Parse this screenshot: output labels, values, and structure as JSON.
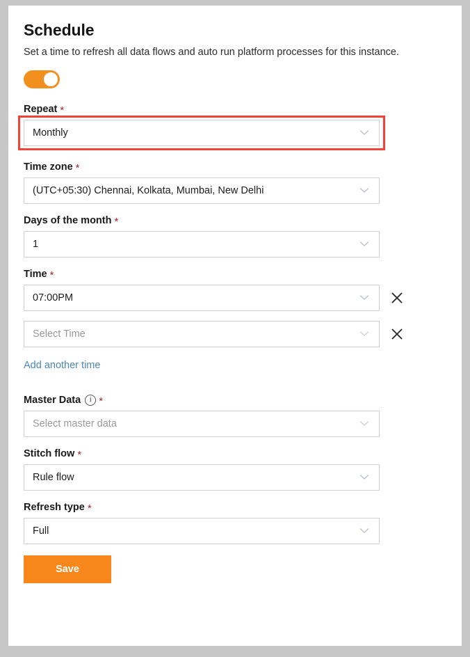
{
  "card": {
    "title": "Schedule",
    "subtitle": "Set a time to refresh all data flows and auto run platform processes for this instance."
  },
  "toggle": {
    "state": "on",
    "color": "#f2901e"
  },
  "fields": {
    "repeat": {
      "label": "Repeat",
      "required": "*",
      "value": "Monthly",
      "highlighted": true,
      "highlight_color": "#f04438"
    },
    "timezone": {
      "label": "Time zone",
      "required": "*",
      "value": "(UTC+05:30) Chennai, Kolkata, Mumbai, New Delhi"
    },
    "days_of_month": {
      "label": "Days of the month",
      "required": "*",
      "value": "1"
    },
    "time": {
      "label": "Time",
      "required": "*",
      "rows": [
        {
          "value": "07:00PM",
          "is_placeholder": false
        },
        {
          "value": "Select Time",
          "is_placeholder": true
        }
      ],
      "add_link": "Add another time"
    },
    "master_data": {
      "label": "Master Data",
      "required": "*",
      "info_icon": "info-icon",
      "value": "Select master data",
      "is_placeholder": true
    },
    "stitch_flow": {
      "label": "Stitch flow",
      "required": "*",
      "value": "Rule flow"
    },
    "refresh_type": {
      "label": "Refresh type",
      "required": "*",
      "value": "Full"
    }
  },
  "actions": {
    "save_label": "Save",
    "save_color": "#f7861b"
  },
  "icons": {
    "chevron": "chevron-down-icon",
    "remove": "close-icon"
  }
}
